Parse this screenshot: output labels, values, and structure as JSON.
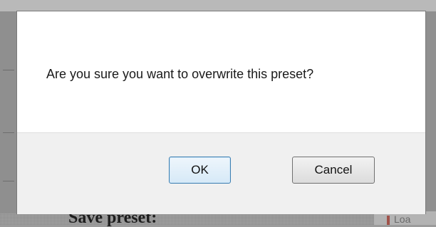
{
  "dialog": {
    "message": "Are you sure you want to overwrite this preset?",
    "ok_label": "OK",
    "cancel_label": "Cancel"
  },
  "background": {
    "heading": "Save preset:",
    "corner_fragment": "Loa"
  }
}
